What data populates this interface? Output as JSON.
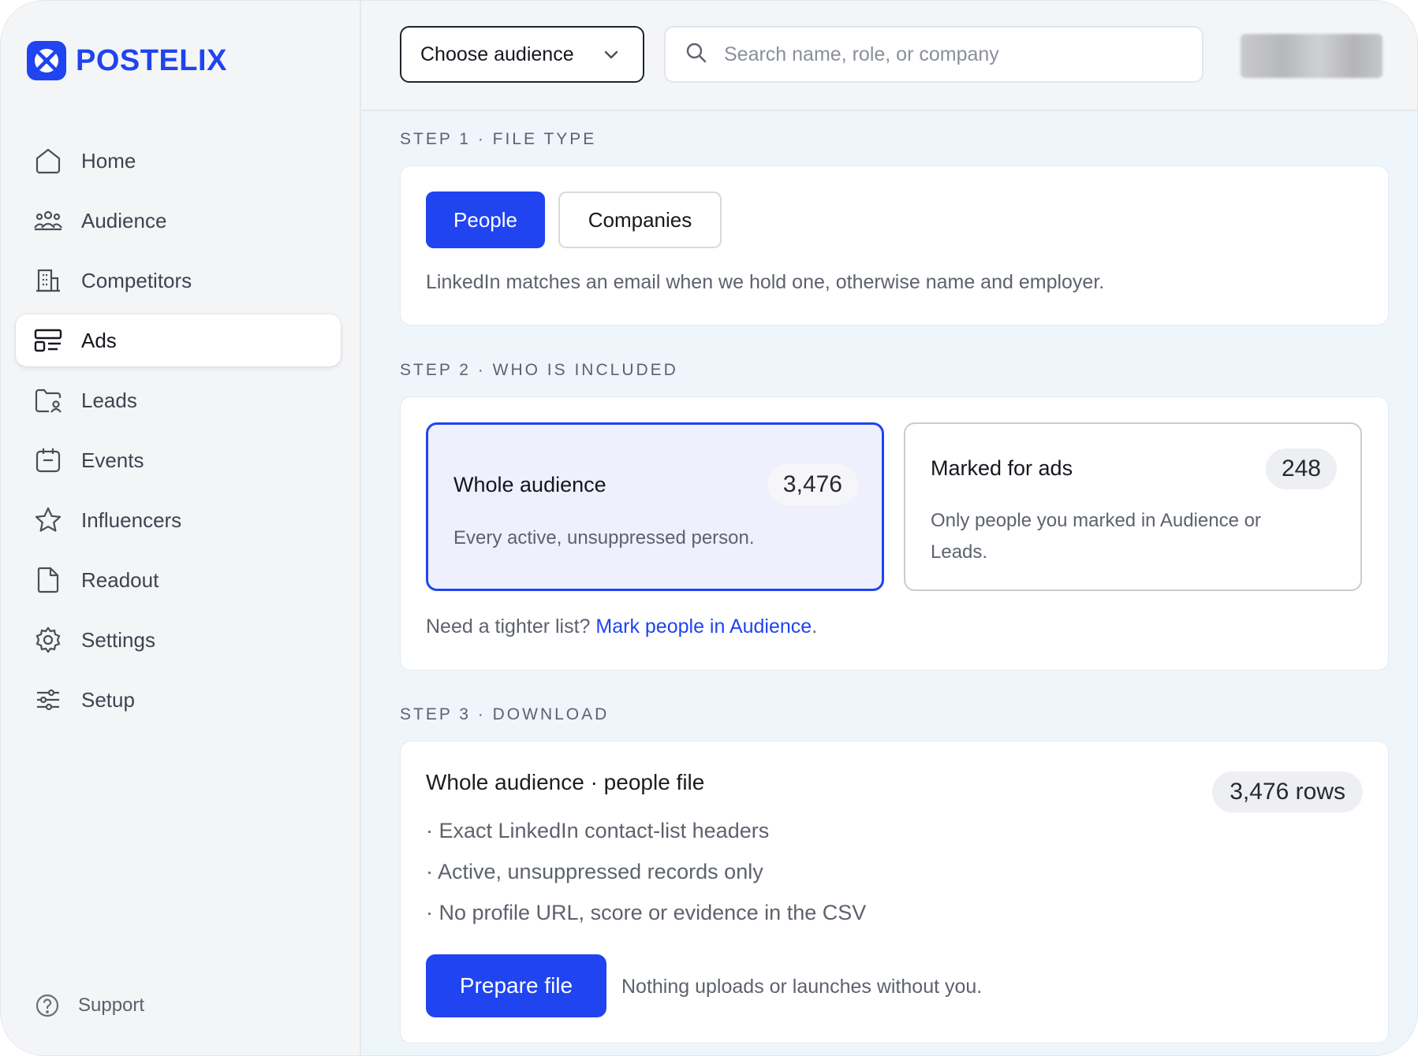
{
  "brand": {
    "name": "POSTELIX",
    "accent": "#1f44f0"
  },
  "sidebar": {
    "items": [
      {
        "label": "Home",
        "icon": "home-icon",
        "active": false
      },
      {
        "label": "Audience",
        "icon": "people-group-icon",
        "active": false
      },
      {
        "label": "Competitors",
        "icon": "building-icon",
        "active": false
      },
      {
        "label": "Ads",
        "icon": "ads-layout-icon",
        "active": true
      },
      {
        "label": "Leads",
        "icon": "folder-user-icon",
        "active": false
      },
      {
        "label": "Events",
        "icon": "calendar-icon",
        "active": false
      },
      {
        "label": "Influencers",
        "icon": "star-icon",
        "active": false
      },
      {
        "label": "Readout",
        "icon": "document-icon",
        "active": false
      },
      {
        "label": "Settings",
        "icon": "gear-icon",
        "active": false
      },
      {
        "label": "Setup",
        "icon": "sliders-icon",
        "active": false
      }
    ],
    "support_label": "Support"
  },
  "topbar": {
    "audience_select": "Choose audience",
    "search_placeholder": "Search name, role, or company",
    "search_value": ""
  },
  "step1": {
    "label": "STEP 1 · FILE TYPE",
    "options": [
      "People",
      "Companies"
    ],
    "selected": "People",
    "hint": "LinkedIn matches an email when we hold one, otherwise name and employer."
  },
  "step2": {
    "label": "STEP 2 · WHO IS INCLUDED",
    "options": [
      {
        "title": "Whole audience",
        "count": "3,476",
        "desc": "Every active, unsuppressed person.",
        "selected": true
      },
      {
        "title": "Marked for ads",
        "count": "248",
        "desc": "Only people you marked in Audience or Leads.",
        "selected": false
      }
    ],
    "tight_prefix": "Need a tighter list? ",
    "tight_link": "Mark people in Audience",
    "tight_suffix": "."
  },
  "step3": {
    "label": "STEP 3 · DOWNLOAD",
    "title": "Whole audience · people file",
    "rows": "3,476 rows",
    "bullets": [
      "· Exact LinkedIn contact-list headers",
      "· Active, unsuppressed records only",
      "· No profile URL, score or evidence in the CSV"
    ],
    "button": "Prepare file",
    "note": "Nothing uploads or launches without you."
  }
}
